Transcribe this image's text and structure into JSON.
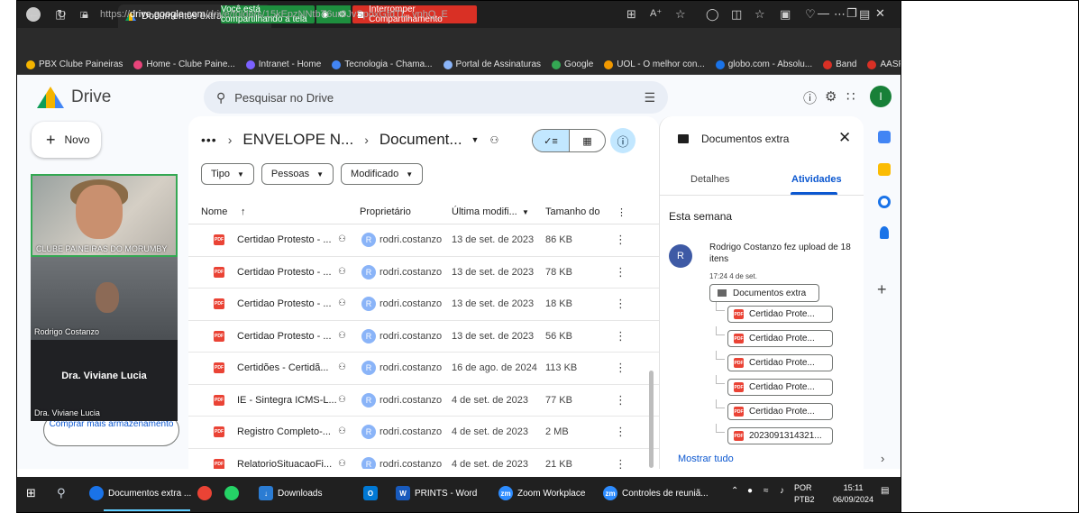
{
  "browser": {
    "tab_title": "Documentos extra - Goo",
    "sharing_text": "Você está compartilhando a tela",
    "stop_sharing": "Interromper Compartilhamento",
    "url_prefix": "https://",
    "url_host": "drive.google.com",
    "url_path": "/drive/folders/15kEpzNNtbT6ur0JvSpoxGfdTL_vnhQ_E",
    "bookmarks": [
      {
        "label": "PBX Clube Paineiras",
        "color": "#f4b400"
      },
      {
        "label": "Home - Clube Paine...",
        "color": "#e8447a"
      },
      {
        "label": "Intranet - Home",
        "color": "#7b61ff"
      },
      {
        "label": "Tecnologia - Chama...",
        "color": "#4285f4"
      },
      {
        "label": "Portal de Assinaturas",
        "color": "#8ab4f8"
      },
      {
        "label": "Google",
        "color": "#34a853"
      },
      {
        "label": "UOL - O melhor con...",
        "color": "#f29900"
      },
      {
        "label": "globo.com - Absolu...",
        "color": "#1a73e8"
      },
      {
        "label": "Band",
        "color": "#d93025"
      },
      {
        "label": "AASP",
        "color": "#d93025"
      }
    ]
  },
  "drive": {
    "app_name": "Drive",
    "search_placeholder": "Pesquisar no Drive",
    "new_label": "Novo",
    "user_initial": "I",
    "storage_label": "Comprar mais armazenamento",
    "breadcrumb": {
      "ellipsis": "•••",
      "parent": "ENVELOPE N...",
      "current": "Document..."
    },
    "filters": [
      "Tipo",
      "Pessoas",
      "Modificado"
    ],
    "columns": {
      "name": "Nome",
      "owner": "Proprietário",
      "modified": "Última modifi...",
      "size": "Tamanho do"
    },
    "files": [
      {
        "name": "Certidao Protesto - ...",
        "owner": "rodri.costanzo",
        "initial": "R",
        "date": "13 de set. de 2023",
        "size": "86 KB"
      },
      {
        "name": "Certidao Protesto - ...",
        "owner": "rodri.costanzo",
        "initial": "R",
        "date": "13 de set. de 2023",
        "size": "78 KB"
      },
      {
        "name": "Certidao Protesto - ...",
        "owner": "rodri.costanzo",
        "initial": "R",
        "date": "13 de set. de 2023",
        "size": "18 KB"
      },
      {
        "name": "Certidao Protesto - ...",
        "owner": "rodri.costanzo",
        "initial": "R",
        "date": "13 de set. de 2023",
        "size": "56 KB"
      },
      {
        "name": "Certidões - Certidã...",
        "owner": "rodri.costanzo",
        "initial": "R",
        "date": "16 de ago. de 2024",
        "size": "113 KB"
      },
      {
        "name": "IE - Sintegra ICMS-L...",
        "owner": "rodri.costanzo",
        "initial": "R",
        "date": "4 de set. de 2023",
        "size": "77 KB"
      },
      {
        "name": "Registro Completo-...",
        "owner": "rodri.costanzo",
        "initial": "R",
        "date": "4 de set. de 2023",
        "size": "2 MB"
      },
      {
        "name": "RelatorioSituacaoFi...",
        "owner": "rodri.costanzo",
        "initial": "R",
        "date": "4 de set. de 2023",
        "size": "21 KB"
      }
    ],
    "details": {
      "title": "Documentos extra",
      "tab_details": "Detalhes",
      "tab_activity": "Atividades",
      "week_label": "Esta semana",
      "activity_initial": "R",
      "activity_text": "Rodrigo Costanzo fez upload de 18 itens",
      "activity_time": "17:24 4 de set.",
      "folder_chip": "Documentos extra",
      "file_chips": [
        "Certidao Prote...",
        "Certidao Prote...",
        "Certidao Prote...",
        "Certidao Prote...",
        "Certidao Prote...",
        "2023091314321..."
      ],
      "show_all": "Mostrar tudo"
    }
  },
  "meeting": {
    "tile1_label": "CLUBE PAINEIRAS DO MORUMBY",
    "tile2_label": "Rodrigo Costanzo",
    "tile3_name": "Dra. Viviane Lucia",
    "tile3_label": "Dra. Viviane Lucia"
  },
  "taskbar": {
    "items": [
      {
        "label": "Documentos extra ...",
        "icon_color": "#1a73e8",
        "icon_text": ""
      },
      {
        "label": "",
        "icon_color": "#ea4335",
        "icon_text": ""
      },
      {
        "label": "",
        "icon_color": "#25d366",
        "icon_text": ""
      },
      {
        "label": "Downloads",
        "icon_color": "#2b7cd3",
        "icon_text": ""
      },
      {
        "label": "",
        "icon_color": "#0078d4",
        "icon_text": "O"
      },
      {
        "label": "PRINTS - Word",
        "icon_color": "#185abd",
        "icon_text": "W"
      },
      {
        "label": "Zoom Workplace",
        "icon_color": "#2d8cff",
        "icon_text": "zm"
      },
      {
        "label": "Controles de reuniã...",
        "icon_color": "#2d8cff",
        "icon_text": "zm"
      }
    ],
    "lang_top": "POR",
    "lang_bottom": "PTB2",
    "time": "15:11",
    "date": "06/09/2024"
  }
}
